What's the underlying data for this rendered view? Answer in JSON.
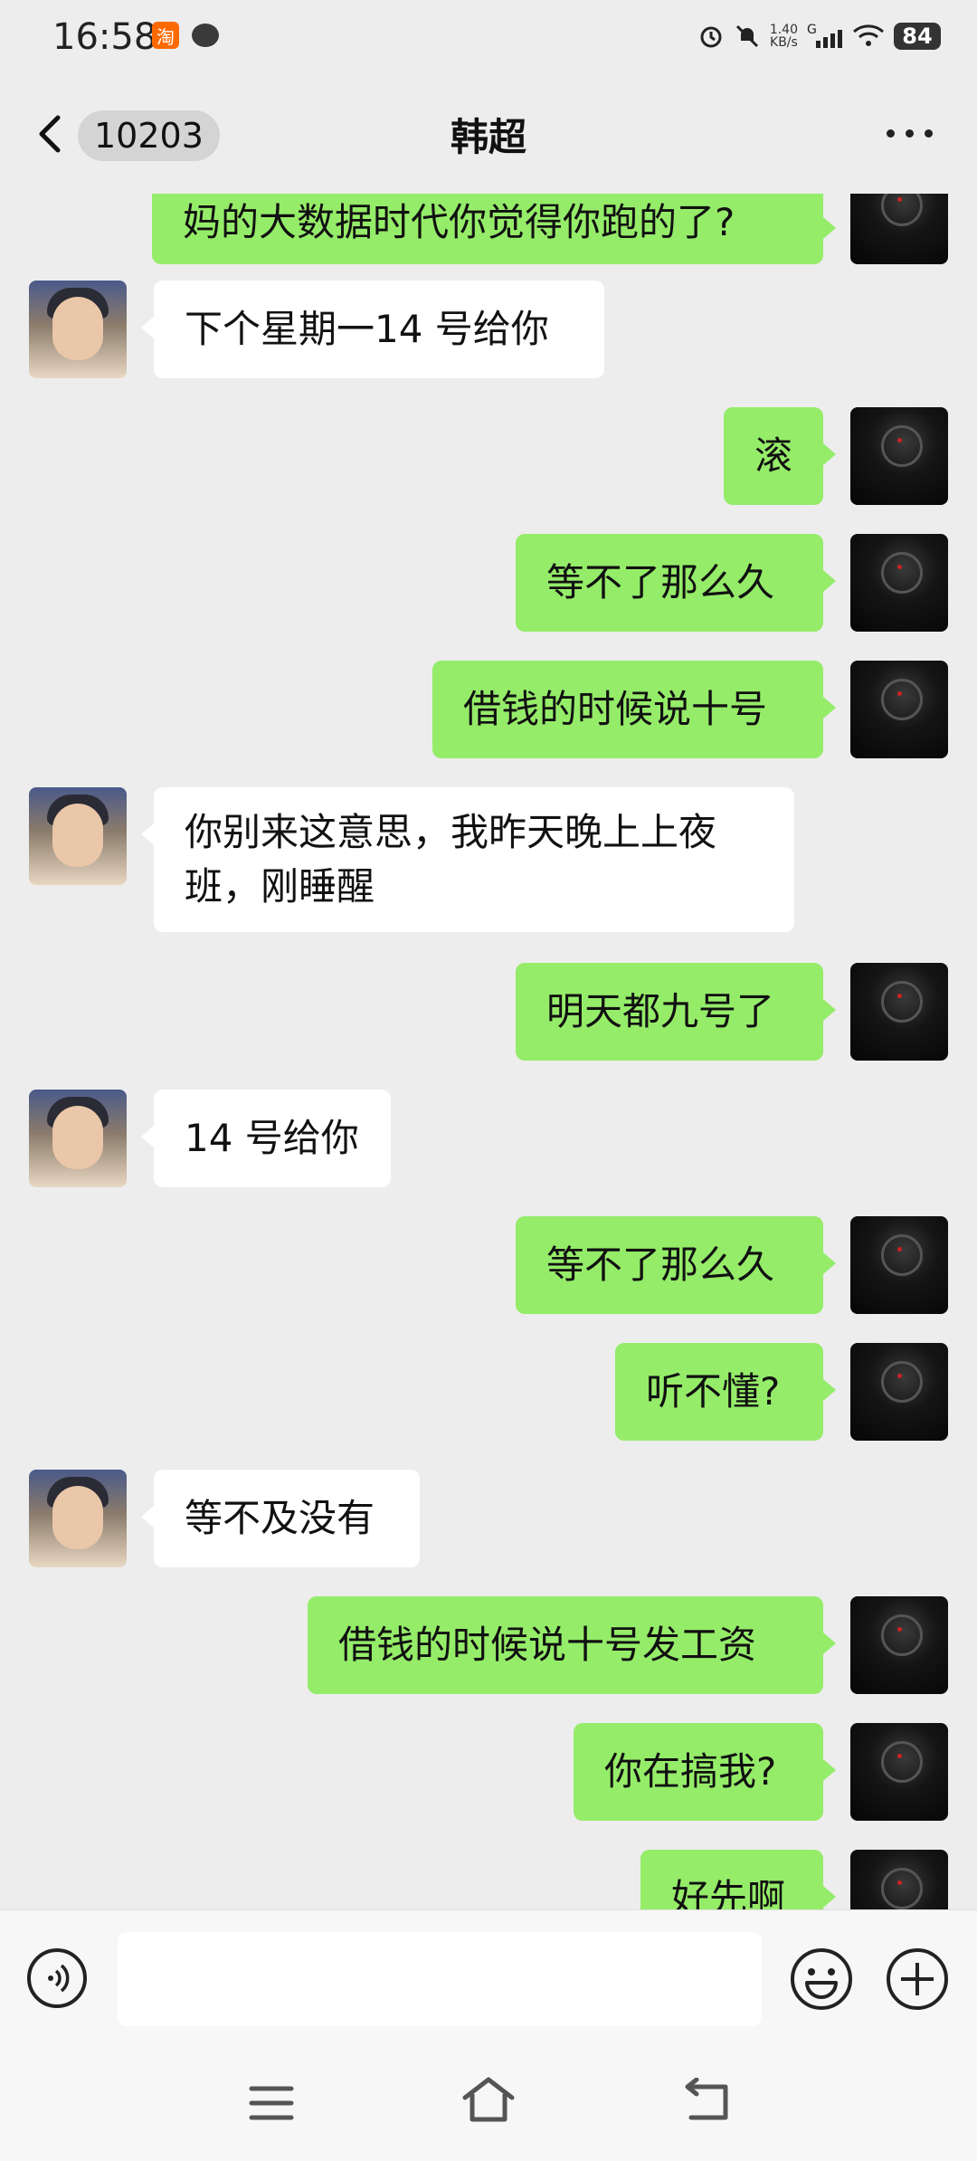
{
  "status_bar": {
    "time": "16:58",
    "app_icon_glyph": "淘",
    "net_speed_value": "1.40",
    "net_speed_unit": "KB/s",
    "network_type": "G",
    "battery": "84",
    "icons": [
      "alarm-icon",
      "mute-icon",
      "signal-icon",
      "wifi-icon",
      "battery-icon"
    ]
  },
  "header": {
    "back_badge": "10203",
    "title": "韩超"
  },
  "messages": [
    {
      "side": "right",
      "text": "妈的大数据时代你觉得你跑的了?"
    },
    {
      "side": "left",
      "text": "下个星期一14 号给你"
    },
    {
      "side": "right",
      "text": "滚"
    },
    {
      "side": "right",
      "text": "等不了那么久"
    },
    {
      "side": "right",
      "text": "借钱的时候说十号"
    },
    {
      "side": "left",
      "text": "你别来这意思，我昨天晚上上夜\n班，刚睡醒"
    },
    {
      "side": "right",
      "text": "明天都九号了"
    },
    {
      "side": "left",
      "text": "14 号给你"
    },
    {
      "side": "right",
      "text": "等不了那么久"
    },
    {
      "side": "right",
      "text": "听不懂?"
    },
    {
      "side": "left",
      "text": "等不及没有"
    },
    {
      "side": "right",
      "text": "借钱的时候说十号发工资"
    },
    {
      "side": "right",
      "text": "你在搞我?"
    },
    {
      "side": "right",
      "text": "好先啊"
    }
  ],
  "input": {
    "value": "",
    "placeholder": ""
  },
  "colors": {
    "background": "#EDEDED",
    "bubble_self": "#95EC69",
    "bubble_other": "#FFFFFF"
  }
}
